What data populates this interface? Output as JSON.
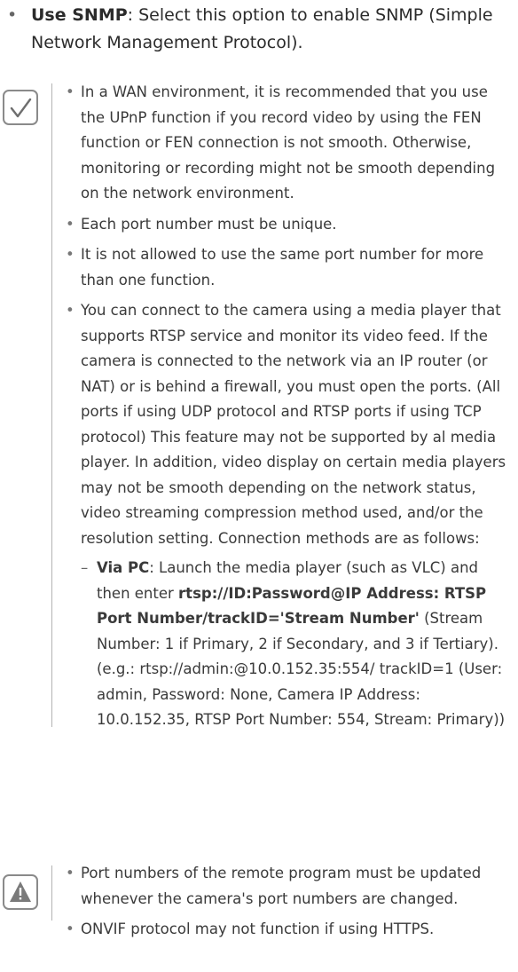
{
  "top_item": {
    "bullet": "•",
    "label": "Use SNMP",
    "text": ": Select this option to enable SNMP (Simple Network Management Protocol)."
  },
  "note_icon": "checkmark-icon",
  "warning_icon": "warning-triangle-icon",
  "bullet_char": "•",
  "dash_char": "–",
  "notes": [
    "In a WAN environment, it is recommended that you use the UPnP function if you record video by using the FEN function or FEN connection is not smooth. Otherwise, monitoring or recording might not be smooth depending on the network environment.",
    "Each port number must be unique.",
    "It is not allowed to use the same port number for more than one function.",
    "You can connect to the camera using a media player that supports RTSP service and monitor its video feed. If the camera is connected to the network via an IP router (or NAT) or is behind a firewall, you must open the ports. (All ports if using UDP protocol and RTSP ports if using TCP protocol) This feature may not be supported by al media player. In addition, video display on certain media players may not be smooth depending on the network status, video streaming compression method used, and/or the resolution setting. Connection methods are as follows:"
  ],
  "via_pc": {
    "label": "Via PC",
    "text1": ": Launch the media player (such as VLC) and then enter ",
    "url": "rtsp://ID:Password@IP Address: RTSP Port Number/trackID='Stream Number'",
    "text2": " (Stream Number: 1 if Primary, 2 if Secondary, and 3 if Tertiary). (e.g.: rtsp://admin:@10.0.152.35:554/ trackID=1 (User: admin, Password: None, Camera IP Address: 10.0.152.35, RTSP Port Number: 554, Stream: Primary))"
  },
  "warnings": [
    "Port numbers of the remote program must be updated whenever the camera's port numbers are changed.",
    "ONVIF protocol may not function if using HTTPS."
  ]
}
